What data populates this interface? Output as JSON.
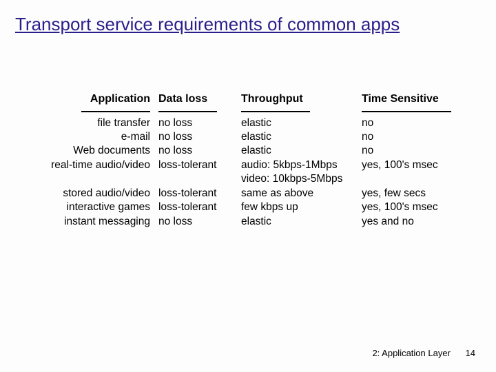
{
  "title": "Transport service requirements of common apps",
  "headers": {
    "application": "Application",
    "data_loss": "Data loss",
    "throughput": "Throughput",
    "time_sensitive": "Time Sensitive"
  },
  "rows": [
    {
      "app": "file transfer",
      "loss": "no loss",
      "tp": "elastic",
      "ts": "no"
    },
    {
      "app": "e-mail",
      "loss": "no loss",
      "tp": "elastic",
      "ts": "no"
    },
    {
      "app": "Web documents",
      "loss": "no loss",
      "tp": "elastic",
      "ts": "no"
    },
    {
      "app": "real-time audio/video",
      "loss": "loss-tolerant",
      "tp": "audio: 5kbps-1Mbps",
      "ts": "yes, 100's msec"
    },
    {
      "app": "",
      "loss": "",
      "tp": "video: 10kbps-5Mbps",
      "ts": ""
    },
    {
      "app": "stored audio/video",
      "loss": "loss-tolerant",
      "tp": "same as above",
      "ts": "yes, few secs"
    },
    {
      "app": "interactive games",
      "loss": "loss-tolerant",
      "tp": "few kbps up",
      "ts": "yes, 100's msec"
    },
    {
      "app": "instant messaging",
      "loss": "no loss",
      "tp": "elastic",
      "ts": "yes and no"
    }
  ],
  "footer": {
    "section": "2: Application Layer",
    "page": "14"
  }
}
